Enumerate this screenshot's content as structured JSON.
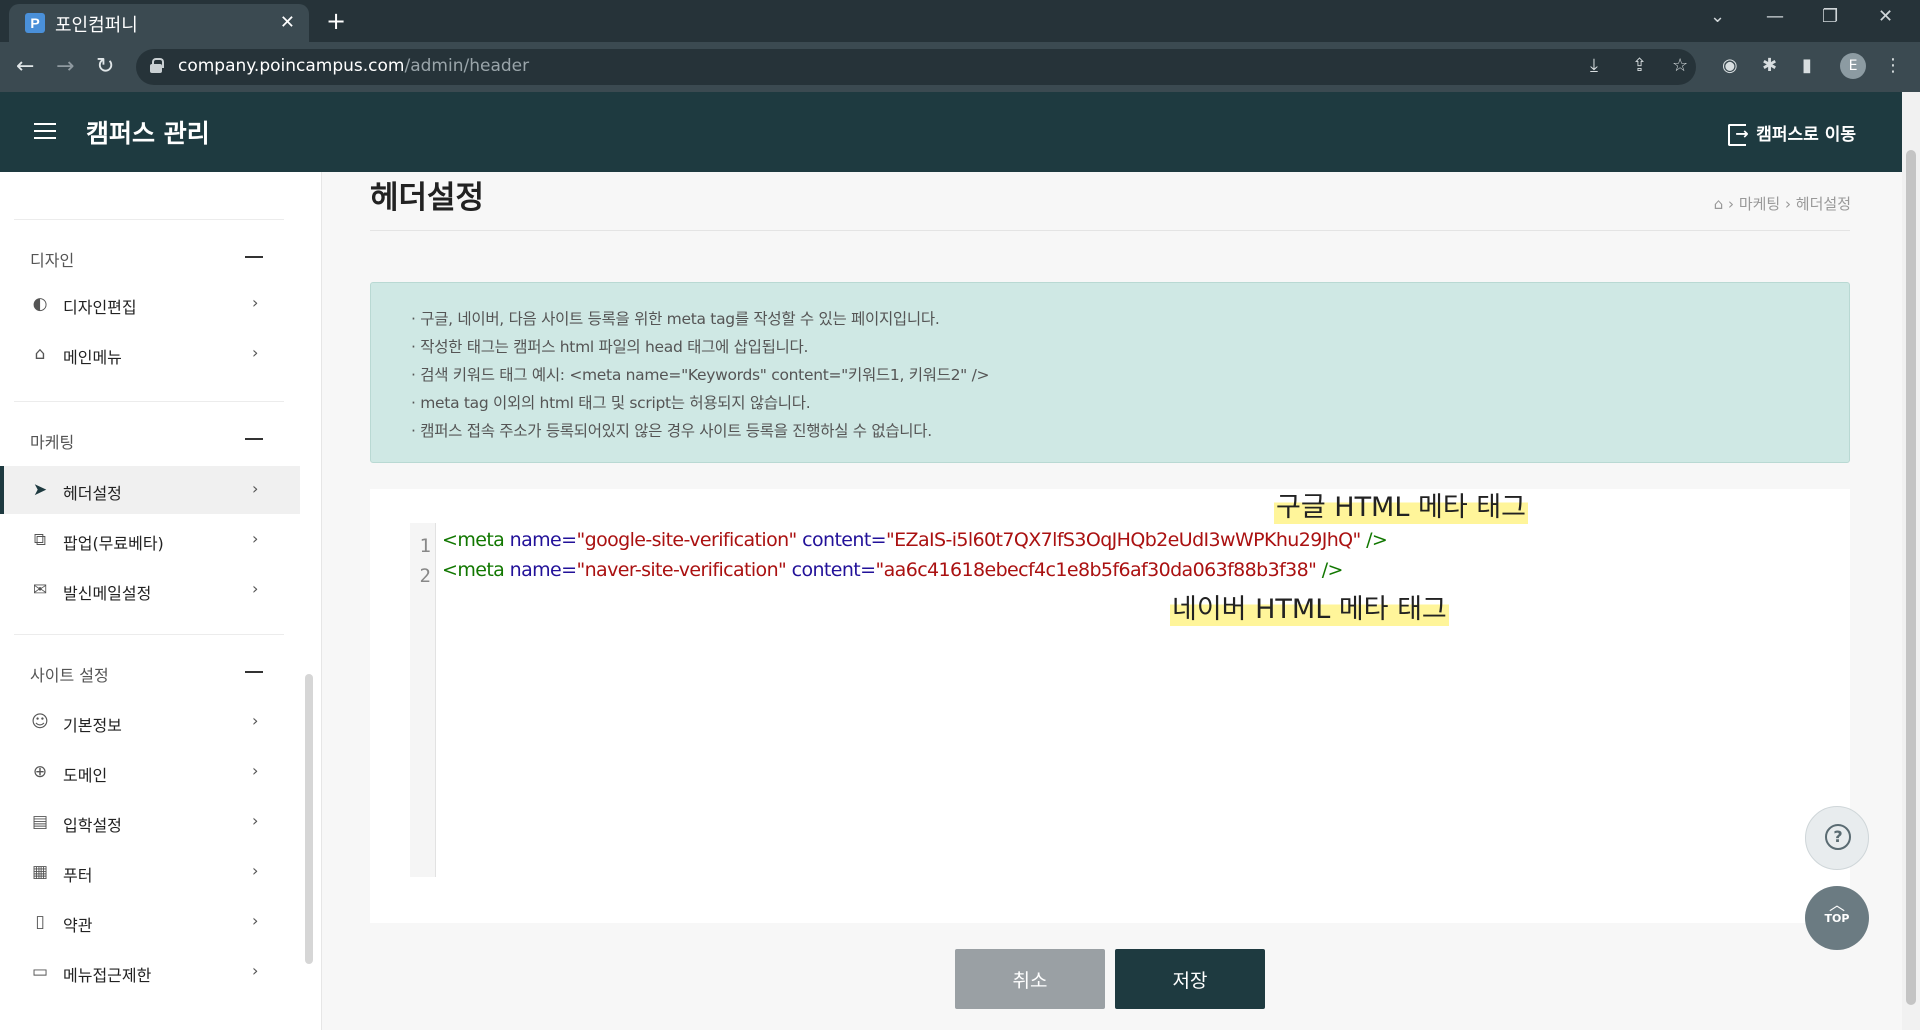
{
  "browser": {
    "tab_title": "포인컴퍼니",
    "tab_favicon_letter": "P",
    "url_host": "company.poincampus.com",
    "url_path": "/admin/header",
    "profile_letter": "E"
  },
  "header": {
    "app_title": "캠퍼스 관리",
    "goto_campus_label": "캠퍼스로 이동"
  },
  "sidebar": {
    "sections": [
      {
        "title": "디자인",
        "items": [
          {
            "label": "디자인편집",
            "icon": "palette-icon"
          },
          {
            "label": "메인메뉴",
            "icon": "tag-icon"
          }
        ]
      },
      {
        "title": "마케팅",
        "items": [
          {
            "label": "헤더설정",
            "icon": "megaphone-icon",
            "active": true
          },
          {
            "label": "팝업(무료베타)",
            "icon": "popup-icon"
          },
          {
            "label": "발신메일설정",
            "icon": "mail-icon"
          }
        ]
      },
      {
        "title": "사이트 설정",
        "items": [
          {
            "label": "기본정보",
            "icon": "users-icon"
          },
          {
            "label": "도메인",
            "icon": "globe-icon"
          },
          {
            "label": "입학설정",
            "icon": "form-icon"
          },
          {
            "label": "푸터",
            "icon": "footer-icon"
          },
          {
            "label": "약관",
            "icon": "document-icon"
          },
          {
            "label": "메뉴접근제한",
            "icon": "menu-lock-icon"
          }
        ]
      }
    ]
  },
  "page": {
    "title": "헤더설정",
    "breadcrumb": [
      "마케팅",
      "헤더설정"
    ],
    "notice_lines": [
      "· 구글, 네이버, 다음 사이트 등록을 위한 meta tag를 작성할 수 있는 페이지입니다.",
      "· 작성한 태그는 캠퍼스 html 파일의 head 태그에 삽입됩니다.",
      "· 검색 키워드 태그 예시: <meta name=\"Keywords\" content=\"키워드1, 키워드2\" />",
      "· meta tag 이외의 html 태그 및 script는 허용되지 않습니다.",
      "· 캠퍼스 접속 주소가 등록되어있지 않은 경우 사이트 등록을 진행하실 수 없습니다."
    ]
  },
  "editor": {
    "lines": [
      {
        "num": "1",
        "tag_open": "<meta",
        "attr1": " name=",
        "val1": "\"google-site-verification\"",
        "attr2": " content=",
        "val2": "\"EZaIS-i5l60t7QX7lfS3OqJHQb2eUdI3wWPKhu29JhQ\"",
        "tag_close": " />"
      },
      {
        "num": "2",
        "tag_open": "<meta",
        "attr1": " name=",
        "val1": "\"naver-site-verification\"",
        "attr2": " content=",
        "val2": "\"aa6c41618ebecf4c1e8b5f6af30da063f88b3f38\"",
        "tag_close": " />"
      }
    ],
    "annotation_google": "구글 HTML 메타 태그",
    "annotation_naver": "네이버 HTML 메타 태그"
  },
  "actions": {
    "cancel_label": "취소",
    "save_label": "저장"
  },
  "floating": {
    "help_symbol": "?",
    "top_label": "TOP"
  },
  "colors": {
    "header_bg": "#1e3a40",
    "notice_bg": "#cfe8e4",
    "highlight": "#fff59a",
    "code_tag": "#117700",
    "code_attr": "#221199",
    "code_string": "#aa1111"
  }
}
